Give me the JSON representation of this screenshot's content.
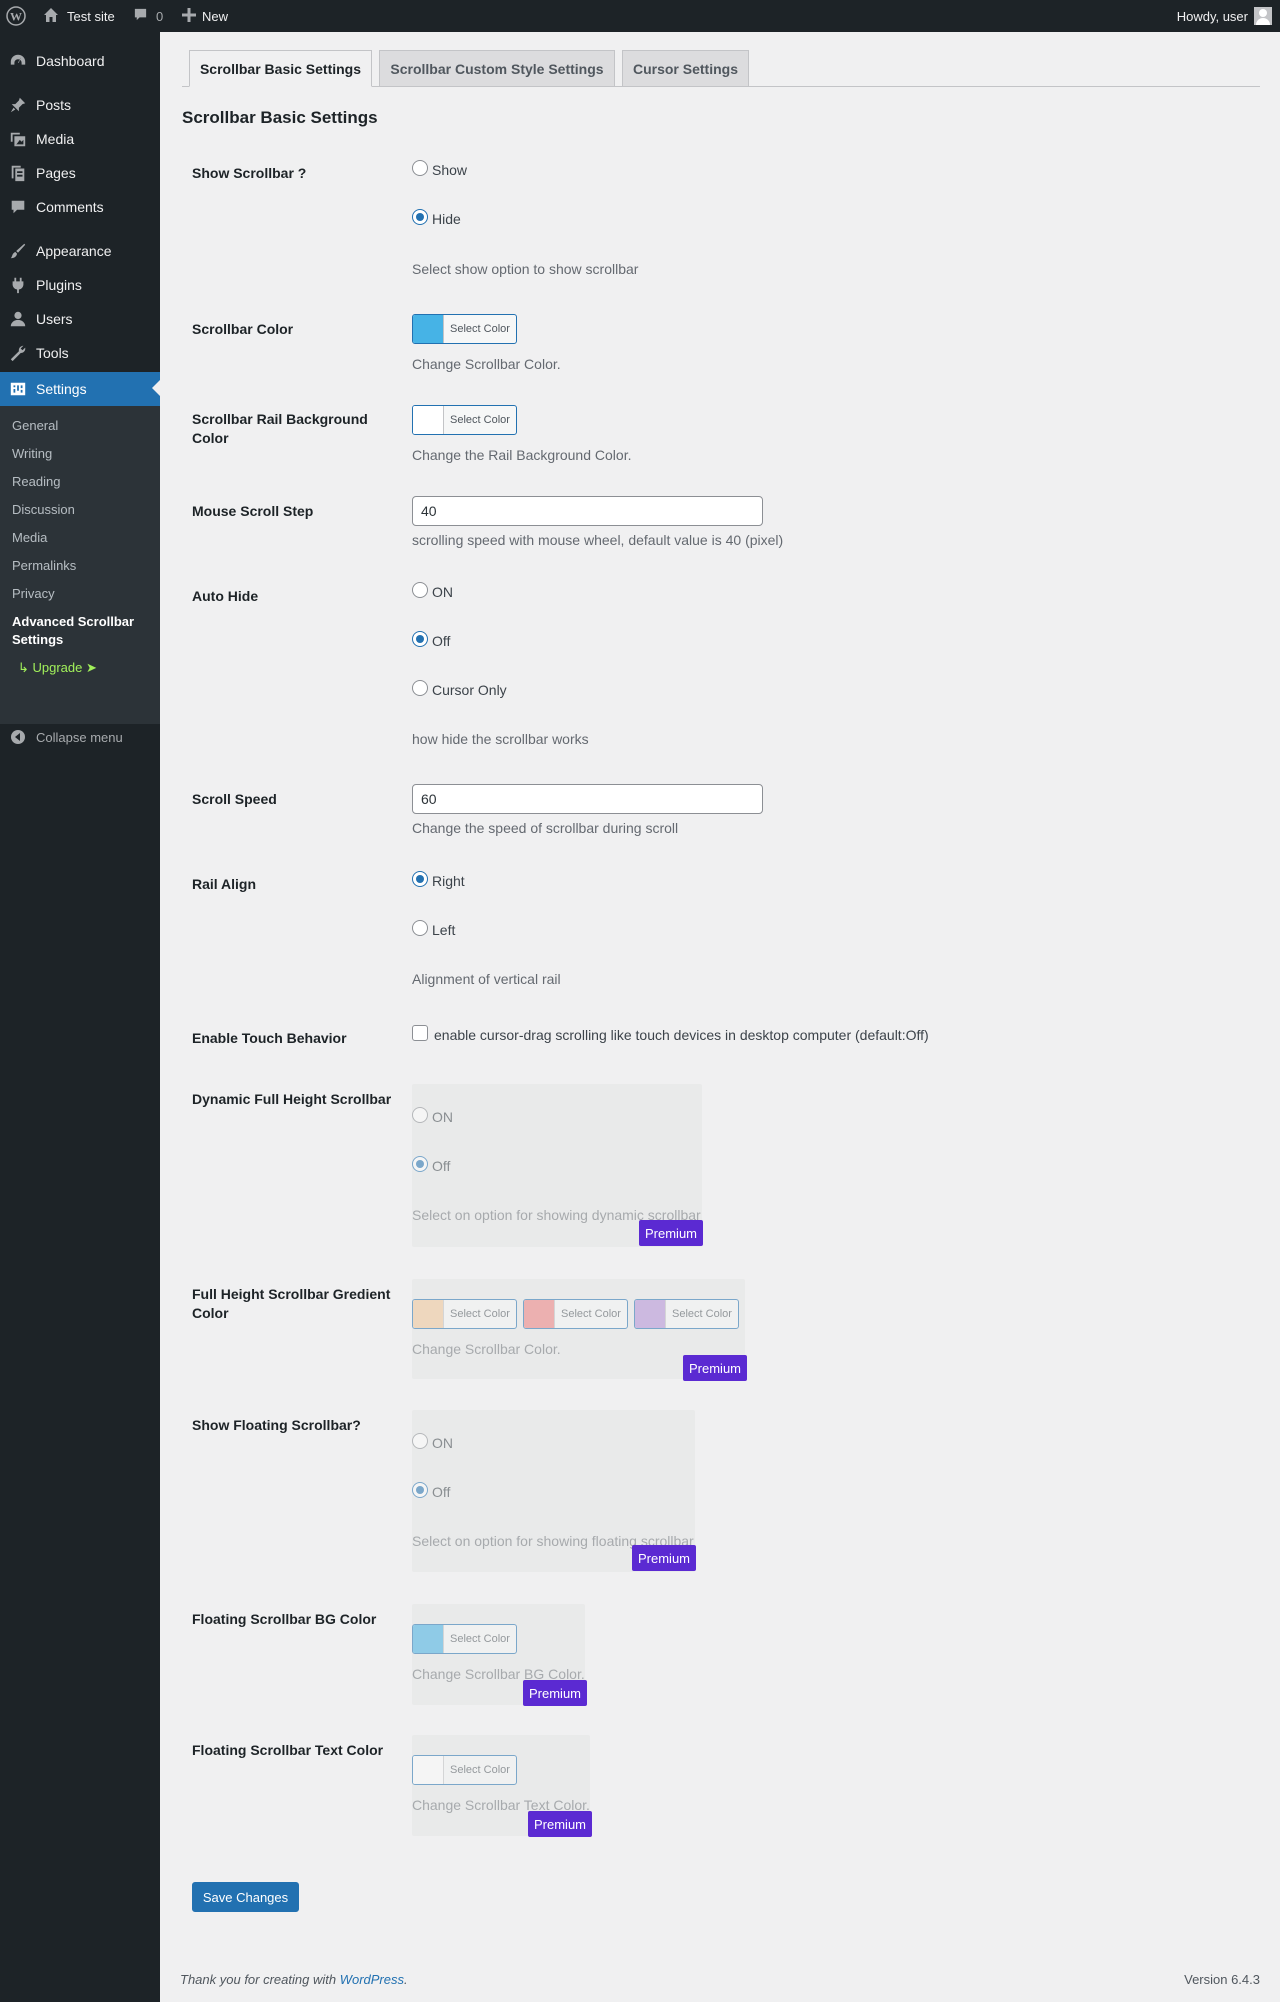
{
  "adminbar": {
    "site_name": "Test site",
    "comments_count": "0",
    "new_label": "New",
    "howdy": "Howdy, user"
  },
  "sidebar": {
    "items": [
      {
        "label": "Dashboard",
        "icon": "dashboard-icon"
      },
      {
        "label": "Posts",
        "icon": "pin-icon"
      },
      {
        "label": "Media",
        "icon": "media-icon"
      },
      {
        "label": "Pages",
        "icon": "pages-icon"
      },
      {
        "label": "Comments",
        "icon": "comment-icon"
      },
      {
        "label": "Appearance",
        "icon": "brush-icon"
      },
      {
        "label": "Plugins",
        "icon": "plug-icon"
      },
      {
        "label": "Users",
        "icon": "user-icon"
      },
      {
        "label": "Tools",
        "icon": "wrench-icon"
      },
      {
        "label": "Settings",
        "icon": "settings-icon"
      }
    ],
    "submenu": [
      "General",
      "Writing",
      "Reading",
      "Discussion",
      "Media",
      "Permalinks",
      "Privacy",
      "Advanced Scrollbar Settings",
      "↳ Upgrade ➤"
    ],
    "collapse_label": "Collapse menu"
  },
  "tabs": [
    "Scrollbar Basic Settings",
    "Scrollbar Custom Style Settings",
    "Cursor Settings"
  ],
  "page_heading": "Scrollbar Basic Settings",
  "colors": {
    "scrollbar_color": "#46b3e6",
    "rail_bg": "#ffffff",
    "gradient_1": "#f3c99b",
    "gradient_2": "#f08282",
    "gradient_3": "#b592d9",
    "floating_bg": "#46b3e6",
    "floating_text": "#ffffff",
    "premium": "#5b2ad2",
    "accent": "#2271b1"
  },
  "fields": {
    "show_scrollbar": {
      "label": "Show Scrollbar ?",
      "opt1": "Show",
      "opt2": "Hide",
      "desc": "Select show option to show scrollbar",
      "selected": "Hide"
    },
    "scrollbar_color": {
      "label": "Scrollbar Color",
      "button": "Select Color",
      "desc": "Change Scrollbar Color."
    },
    "rail_bg": {
      "label": "Scrollbar Rail Background Color",
      "button": "Select Color",
      "desc": "Change the Rail Background Color."
    },
    "mouse_step": {
      "label": "Mouse Scroll Step",
      "value": "40",
      "desc": "scrolling speed with mouse wheel, default value is 40 (pixel)"
    },
    "auto_hide": {
      "label": "Auto Hide",
      "opt1": "ON",
      "opt2": "Off",
      "opt3": "Cursor Only",
      "desc": "how hide the scrollbar works",
      "selected": "Off"
    },
    "scroll_speed": {
      "label": "Scroll Speed",
      "value": "60",
      "desc": "Change the speed of scrollbar during scroll"
    },
    "rail_align": {
      "label": "Rail Align",
      "opt1": "Right",
      "opt2": "Left",
      "desc": "Alignment of vertical rail",
      "selected": "Right"
    },
    "touch": {
      "label": "Enable Touch Behavior",
      "desc": "enable cursor-drag scrolling like touch devices in desktop computer (default:Off)"
    },
    "dynamic_full": {
      "label": "Dynamic Full Height Scrollbar",
      "opt1": "ON",
      "opt2": "Off",
      "desc": "Select on option for showing dynamic scrollbar",
      "badge": "Premium"
    },
    "gradient": {
      "label": "Full Height Scrollbar Gredient Color",
      "button": "Select Color",
      "desc": "Change Scrollbar Color.",
      "badge": "Premium"
    },
    "floating": {
      "label": "Show Floating Scrollbar?",
      "opt1": "ON",
      "opt2": "Off",
      "desc": "Select on option for showing floating scrollbar",
      "badge": "Premium"
    },
    "floating_bg": {
      "label": "Floating Scrollbar BG Color",
      "button": "Select Color",
      "desc": "Change Scrollbar BG Color.",
      "badge": "Premium"
    },
    "floating_text": {
      "label": "Floating Scrollbar Text Color",
      "button": "Select Color",
      "desc": "Change Scrollbar Text Color.",
      "badge": "Premium"
    }
  },
  "save_label": "Save Changes",
  "footer": {
    "thanks": "Thank you for creating with ",
    "link": "WordPress",
    "period": ".",
    "version": "Version 6.4.3"
  }
}
